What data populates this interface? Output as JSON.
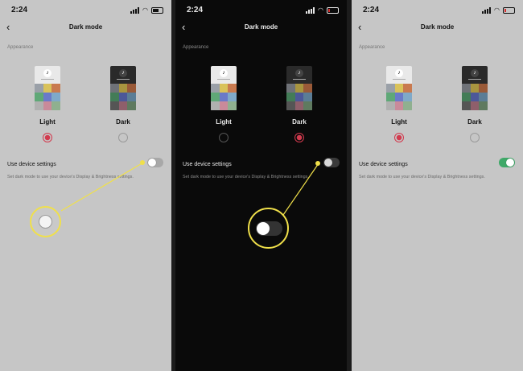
{
  "status_time": "2:24",
  "nav_title": "Dark mode",
  "section_label": "Appearance",
  "options": {
    "light_label": "Light",
    "dark_label": "Dark"
  },
  "setting_label": "Use device settings",
  "setting_hint": "Set dark mode to use your device's Display & Brightness settings.",
  "icons": [
    "back-chevron-icon",
    "tiktok-logo-icon",
    "signal-icon",
    "wifi-icon",
    "battery-icon"
  ],
  "colors": {
    "accent": "#d23a4e",
    "highlight": "#f0e04a",
    "toggle_on": "#3fa868",
    "toggle_off_light": "#a8a8a8",
    "toggle_off_dark": "#3a3a3a"
  },
  "screens": [
    {
      "theme": "light",
      "selected_option": "Light",
      "use_device_settings": false
    },
    {
      "theme": "dark",
      "selected_option": "Dark",
      "use_device_settings": false
    },
    {
      "theme": "light",
      "selected_option": "Light",
      "use_device_settings": true
    }
  ]
}
